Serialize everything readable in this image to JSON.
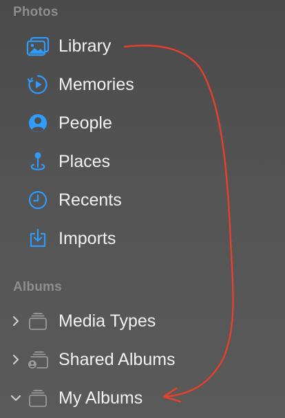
{
  "colors": {
    "accent": "#2f9bff",
    "album_icon": "#9a9a9a",
    "annotation_arrow": "#e8402a",
    "label": "#f2f2f2",
    "section_header": "#8e8e8e"
  },
  "sidebar": {
    "photos_section": {
      "header": "Photos",
      "items": [
        {
          "label": "Library",
          "icon": "photo-library-icon"
        },
        {
          "label": "Memories",
          "icon": "memories-icon"
        },
        {
          "label": "People",
          "icon": "person-icon"
        },
        {
          "label": "Places",
          "icon": "map-pin-icon"
        },
        {
          "label": "Recents",
          "icon": "clock-icon"
        },
        {
          "label": "Imports",
          "icon": "import-icon"
        }
      ]
    },
    "albums_section": {
      "header": "Albums",
      "items": [
        {
          "label": "Media Types",
          "icon": "album-stack-icon",
          "expanded": false
        },
        {
          "label": "Shared Albums",
          "icon": "shared-album-stack-icon",
          "expanded": false
        },
        {
          "label": "My Albums",
          "icon": "album-stack-icon",
          "expanded": true
        }
      ]
    }
  }
}
